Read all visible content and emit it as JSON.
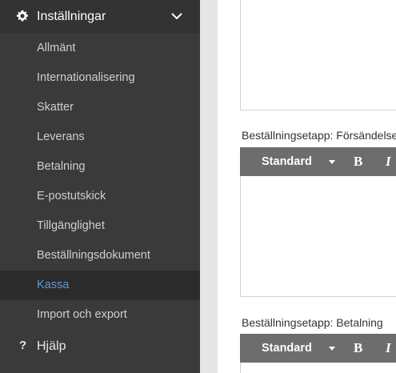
{
  "sidebar": {
    "settings_label": "Inställningar",
    "items": [
      {
        "label": "Allmänt"
      },
      {
        "label": "Internationalisering"
      },
      {
        "label": "Skatter"
      },
      {
        "label": "Leverans"
      },
      {
        "label": "Betalning"
      },
      {
        "label": "E-postutskick"
      },
      {
        "label": "Tillgänglighet"
      },
      {
        "label": "Beställningsdokument"
      },
      {
        "label": "Kassa",
        "active": true
      },
      {
        "label": "Import och export"
      }
    ],
    "help_label": "Hjälp",
    "active_color": "#5b9bd1"
  },
  "content": {
    "field1_label": "Beställningsetapp: Försändelse",
    "field2_label": "Beställningsetapp: Betalning",
    "toolbar": {
      "format_label": "Standard",
      "bold_label": "B",
      "italic_label": "I"
    }
  },
  "icons": [
    "gear-icon",
    "chevron-down-icon",
    "help-icon",
    "dropdown-caret-icon"
  ]
}
